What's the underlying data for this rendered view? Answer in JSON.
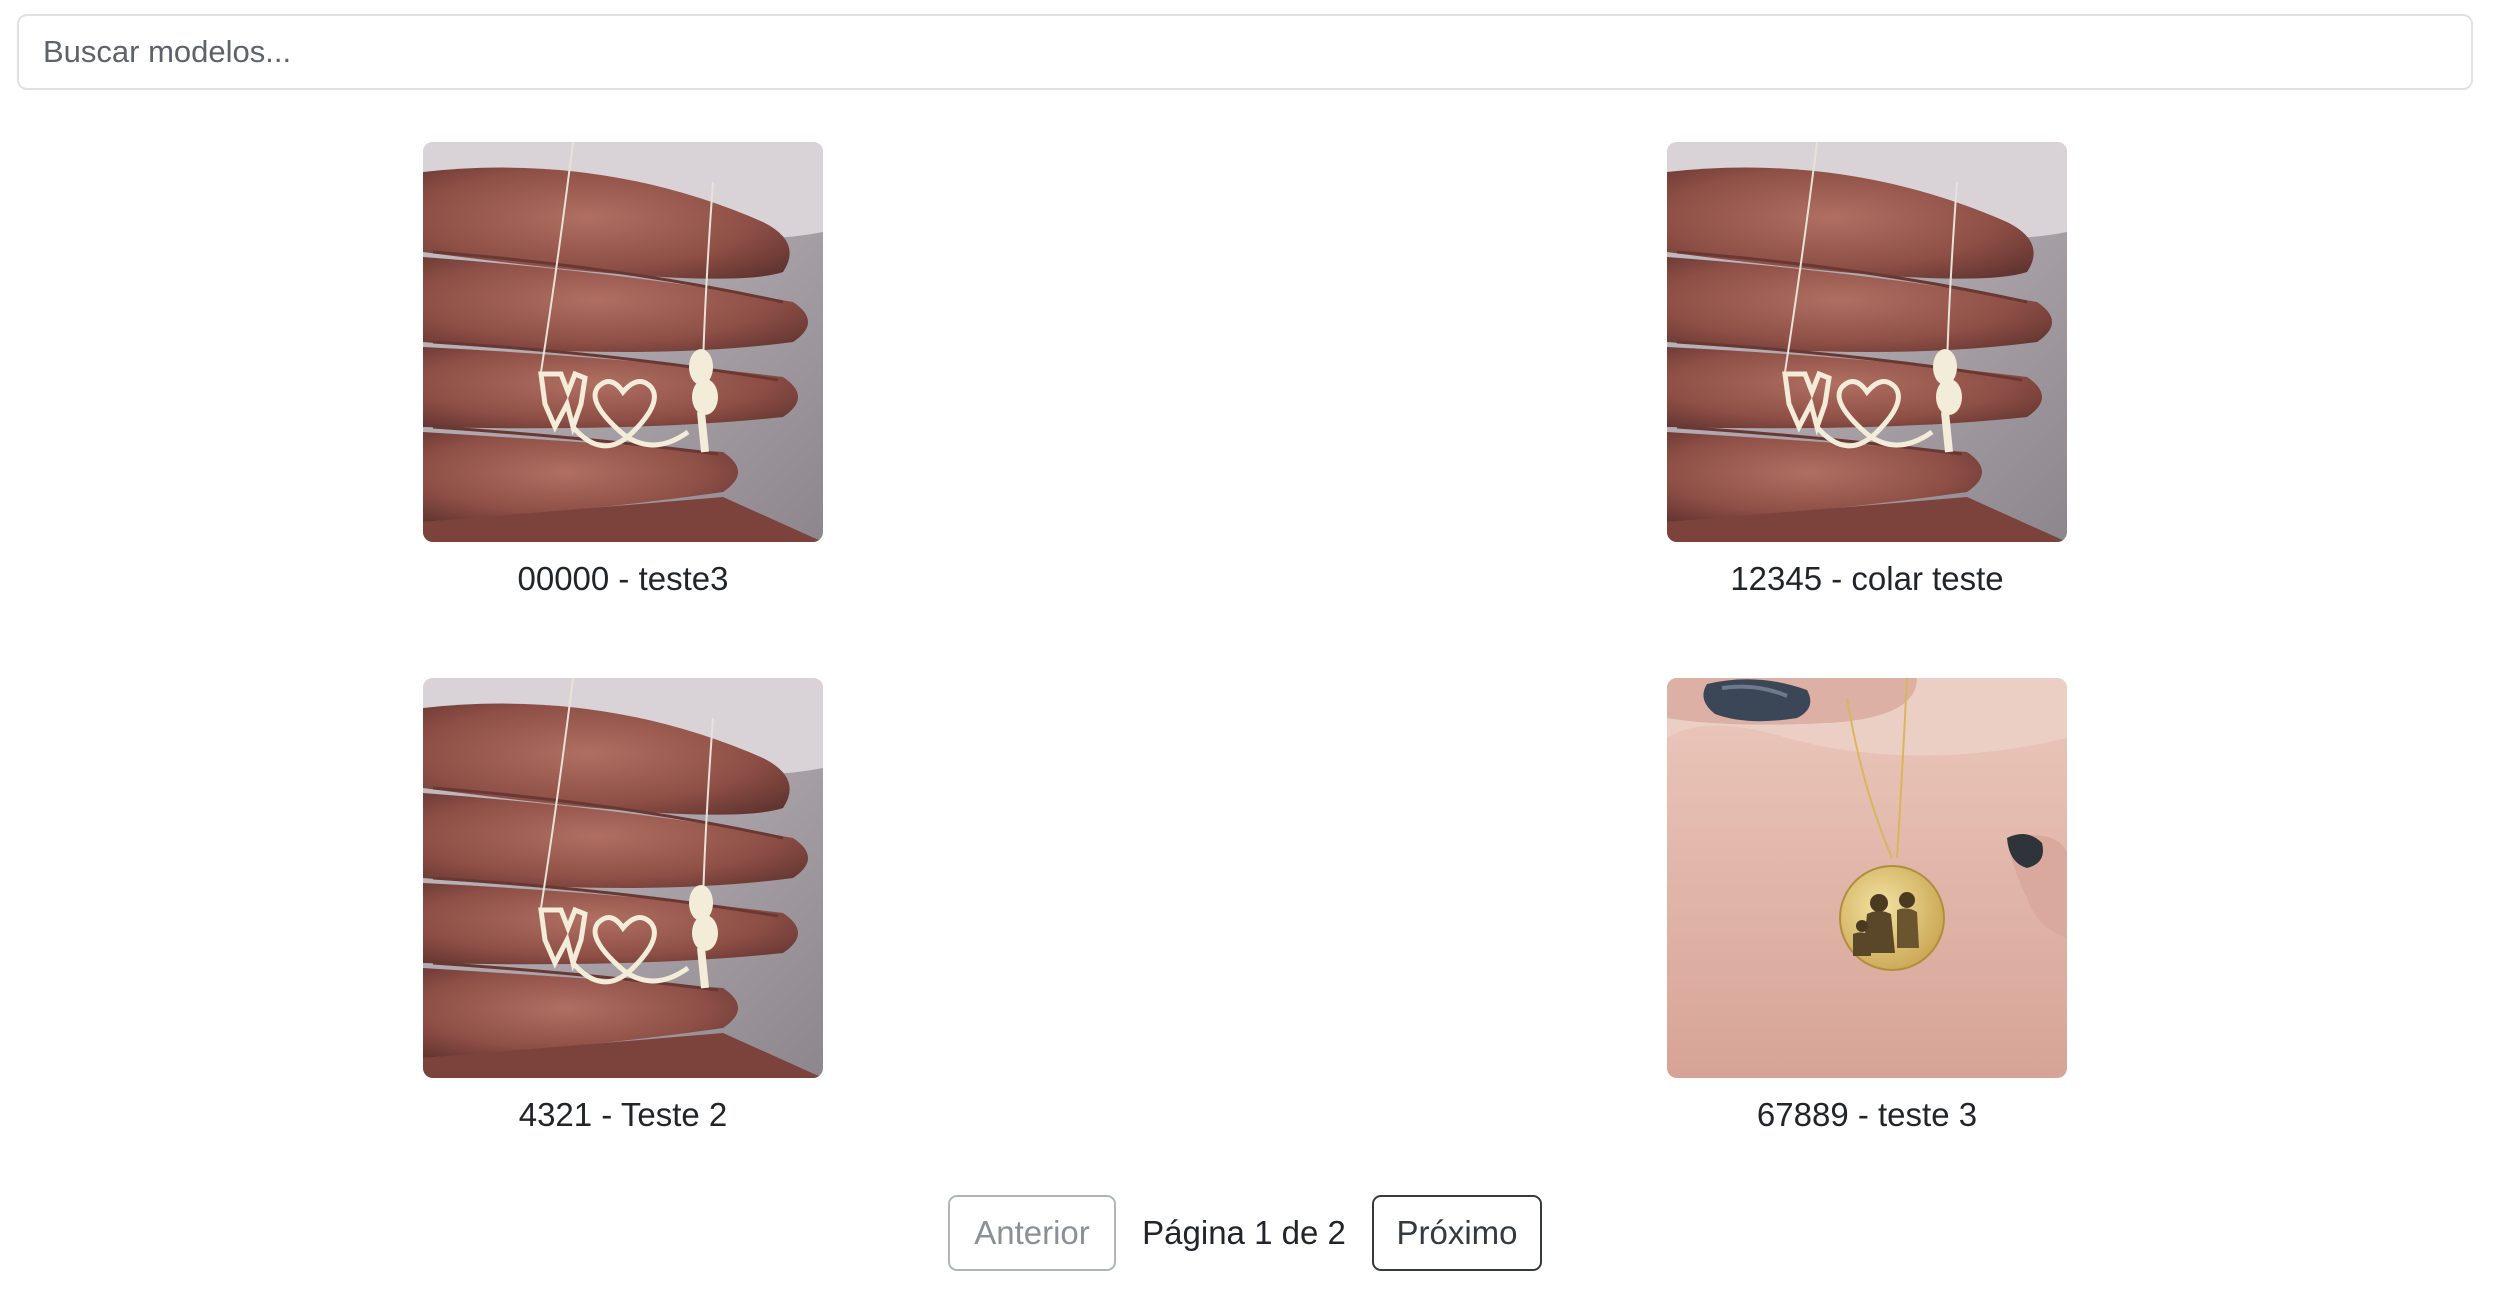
{
  "search": {
    "placeholder": "Buscar modelos...",
    "value": ""
  },
  "products": [
    {
      "caption": "00000 - teste3",
      "image": "silver-dental-necklace-photo"
    },
    {
      "caption": "12345 - colar teste",
      "image": "silver-dental-necklace-photo"
    },
    {
      "caption": "4321 - Teste 2",
      "image": "silver-dental-necklace-photo"
    },
    {
      "caption": "67889 - teste 3",
      "image": "gold-photo-pendant-photo"
    }
  ],
  "pagination": {
    "prev_label": "Anterior",
    "info": "Página 1 de 2",
    "next_label": "Próximo",
    "prev_disabled": true
  },
  "colors": {
    "text": "#212529",
    "border": "#dee2e6",
    "disabled": "#adb5bd"
  }
}
